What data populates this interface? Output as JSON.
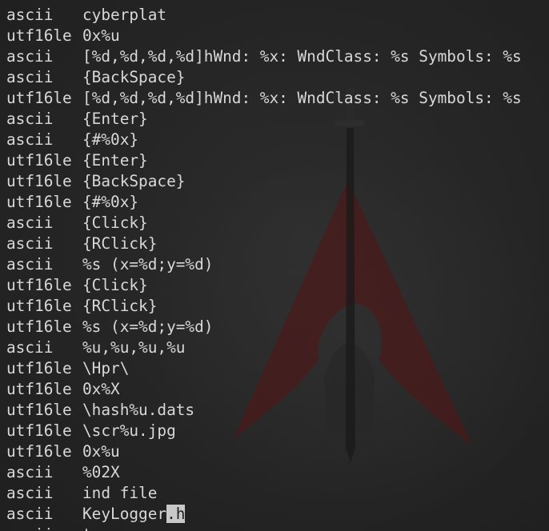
{
  "terminal": {
    "lines": [
      {
        "encoding": "ascii",
        "text": "cyberplat"
      },
      {
        "encoding": "utf16le",
        "text": "0x%u"
      },
      {
        "encoding": "ascii",
        "text": "[%d,%d,%d,%d]hWnd: %x: WndClass: %s Symbols: %s"
      },
      {
        "encoding": "ascii",
        "text": "{BackSpace}"
      },
      {
        "encoding": "utf16le",
        "text": "[%d,%d,%d,%d]hWnd: %x: WndClass: %s Symbols: %s"
      },
      {
        "encoding": "ascii",
        "text": "{Enter}"
      },
      {
        "encoding": "ascii",
        "text": "{#%0x}"
      },
      {
        "encoding": "utf16le",
        "text": "{Enter}"
      },
      {
        "encoding": "utf16le",
        "text": "{BackSpace}"
      },
      {
        "encoding": "utf16le",
        "text": "{#%0x}"
      },
      {
        "encoding": "ascii",
        "text": "{Click}"
      },
      {
        "encoding": "ascii",
        "text": "{RClick}"
      },
      {
        "encoding": "ascii",
        "text": "%s (x=%d;y=%d)"
      },
      {
        "encoding": "utf16le",
        "text": "{Click}"
      },
      {
        "encoding": "utf16le",
        "text": "{RClick}"
      },
      {
        "encoding": "utf16le",
        "text": "%s (x=%d;y=%d)"
      },
      {
        "encoding": "ascii",
        "text": "%u,%u,%u,%u"
      },
      {
        "encoding": "utf16le",
        "text": "\\Hpr\\"
      },
      {
        "encoding": "utf16le",
        "text": "0x%X"
      },
      {
        "encoding": "utf16le",
        "text": "\\hash%u.dats"
      },
      {
        "encoding": "utf16le",
        "text": "\\scr%u.jpg"
      },
      {
        "encoding": "utf16le",
        "text": "0x%u"
      },
      {
        "encoding": "ascii",
        "text": "%02X"
      },
      {
        "encoding": "ascii",
        "text": "ind file"
      },
      {
        "encoding": "ascii",
        "text": "KeyLogger",
        "highlight": ".h"
      },
      {
        "encoding": "ascii",
        "text": "t"
      }
    ]
  },
  "colors": {
    "text": "#d8d8d8",
    "background": "#232323",
    "wallpaper_accent": "#5a1a1c",
    "highlight_bg": "#c8c8c8"
  },
  "icons": {
    "wallpaper": "arch-linux-sword-logo"
  }
}
